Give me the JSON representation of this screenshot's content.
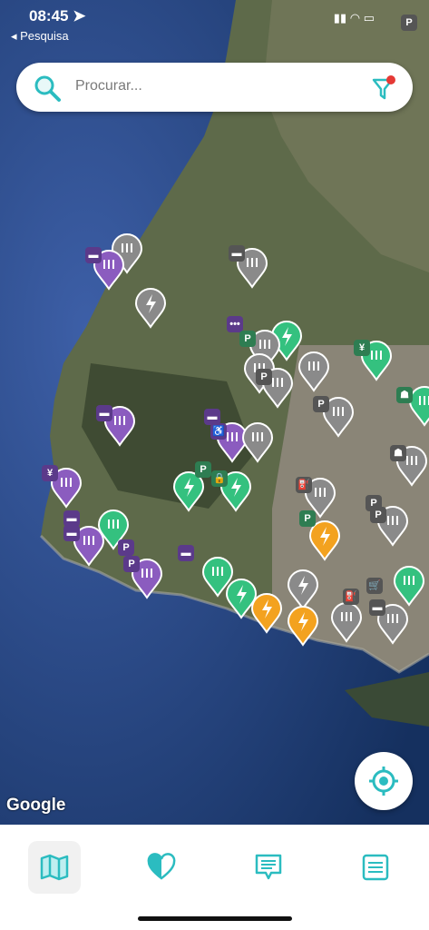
{
  "status": {
    "time": "08:45",
    "back_label": "◂ Pesquisa"
  },
  "search": {
    "placeholder": "Procurar..."
  },
  "map": {
    "attribution": "Google"
  },
  "colors": {
    "accent": "#2bbcc0",
    "green": "#34c17f",
    "purple": "#8b5cbf",
    "grey": "#8a8a8a",
    "orange": "#f3a21f",
    "filter_dot": "#e53935"
  },
  "tabs": [
    {
      "name": "map",
      "icon": "map-icon",
      "active": true
    },
    {
      "name": "favorites",
      "icon": "heart-icon",
      "active": false
    },
    {
      "name": "messages",
      "icon": "chat-icon",
      "active": false
    },
    {
      "name": "list",
      "icon": "list-icon",
      "active": false
    }
  ]
}
